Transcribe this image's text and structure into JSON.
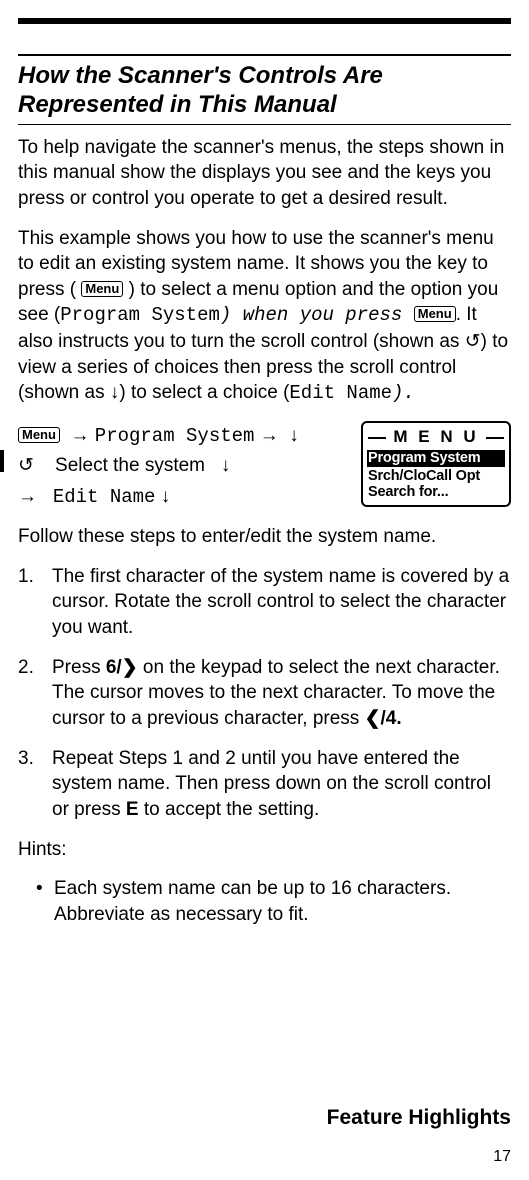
{
  "title": "How the Scanner's Controls Are Represented in This Manual",
  "p1": "To help navigate the scanner's menus, the steps shown in this manual show the displays you see and the keys you press or control you operate to get a desired result.",
  "p2a": "This example shows you how to use the scanner's menu to edit an existing system name. It shows you the key to press (",
  "p2b": ") to select a menu option and the option you see (",
  "menuOption": "Program System",
  "p2c": ") when you press ",
  "p2d": ". It also instructs you to turn the scroll control (shown as ",
  "turnSym": "↺",
  "p2e": ") to view a series of choices then press the scroll control (shown as ",
  "pressSym": "↓",
  "p2f": ") to select a choice (",
  "editName": "Edit Name",
  "p2g": ").",
  "key": "Menu",
  "nav": {
    "l1a": "Program System",
    "l2a": "Select the system",
    "l3a": "Edit Name",
    "pressSym": "↓",
    "turnSym": "↺",
    "arrow": "→"
  },
  "lcd": {
    "title": "M E N U",
    "r1": "Program System",
    "r2": "Srch/CloCall Opt",
    "r3": "Search for..."
  },
  "afterLcd": "Follow these steps to enter/edit the system name.",
  "steps": [
    {
      "n": "1.",
      "t": "The first character of the system name is covered by a cursor. Rotate the scroll control to select the character you want."
    },
    {
      "n": "2.",
      "pre": "Press ",
      "key1": "6/",
      "key1sym": "❯",
      "mid": " on the keypad to select the next character. The cursor moves to the next character. To move the cursor to a previous character, press ",
      "key2sym": "❮",
      "key2": "/4."
    },
    {
      "n": "3.",
      "pre": "Repeat Steps 1 and 2 until you have entered the system name. Then press down on the scroll control or press ",
      "e": "E",
      "post": " to accept the setting."
    }
  ],
  "hintsLabel": "Hints:",
  "hints": [
    "Each system name can be up to 16 characters. Abbreviate as necessary to fit."
  ],
  "footer": "Feature Highlights",
  "pagenum": "17"
}
